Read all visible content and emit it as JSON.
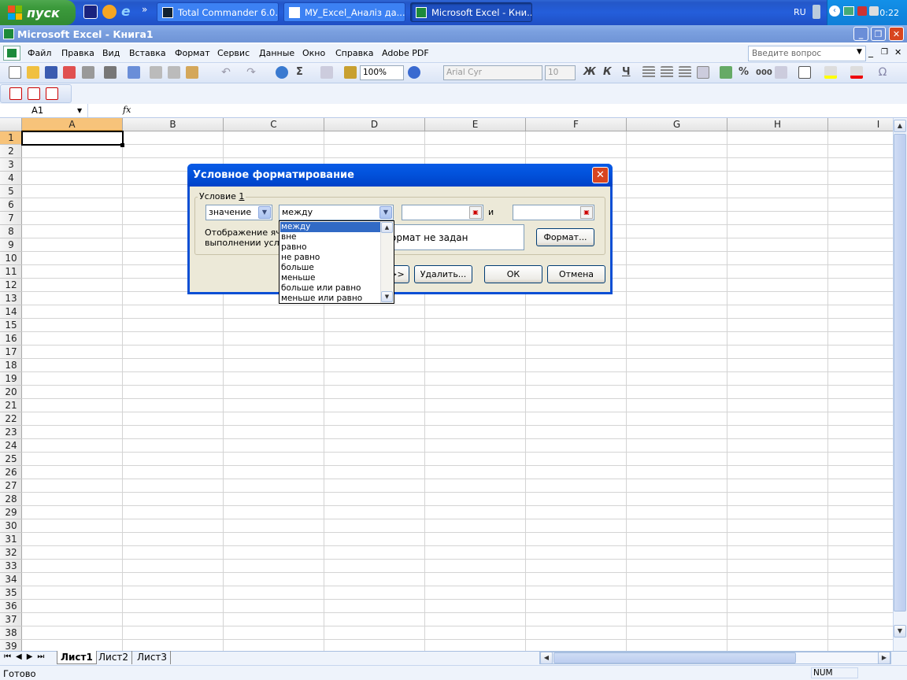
{
  "taskbar": {
    "start_label": "пуск",
    "quick_launch": [
      "total-commander-icon",
      "winamp-icon",
      "internet-explorer-icon"
    ],
    "more": "»",
    "buttons": [
      {
        "label": "Total Commander 6.0..."
      },
      {
        "label": "МУ_Excel_Аналіз да..."
      },
      {
        "label": "Microsoft Excel - Кни..."
      }
    ],
    "lang": "RU",
    "clock": "0:22"
  },
  "window": {
    "title": "Microsoft Excel - Книга1",
    "min": "_",
    "max": "❐",
    "close": "✕"
  },
  "menu": {
    "items": [
      "Файл",
      "Правка",
      "Вид",
      "Вставка",
      "Формат",
      "Сервис",
      "Данные",
      "Окно",
      "Справка",
      "Adobe PDF"
    ],
    "ask_placeholder": "Введите вопрос"
  },
  "toolbar": {
    "zoom": "100%",
    "font": "Arial Cyr",
    "size": "10",
    "bold": "Ж",
    "italic": "К",
    "underline": "Ч",
    "percent": "%",
    "thousands": "000",
    "sigma": "Σ"
  },
  "formula": {
    "namebox": "A1",
    "fx": "fx",
    "content": ""
  },
  "grid": {
    "columns": [
      "A",
      "B",
      "C",
      "D",
      "E",
      "F",
      "G",
      "H",
      "I"
    ],
    "rows": [
      "1",
      "2",
      "3",
      "4",
      "5",
      "6",
      "7",
      "8",
      "9",
      "10",
      "11",
      "12",
      "13",
      "14",
      "15",
      "16",
      "17",
      "18",
      "19",
      "20",
      "21",
      "22",
      "23",
      "24",
      "25",
      "26",
      "27",
      "28",
      "29",
      "30",
      "31",
      "32",
      "33",
      "34",
      "35",
      "36",
      "37",
      "38",
      "39"
    ],
    "active_cell": "A1"
  },
  "sheets": [
    "Лист1",
    "Лист2",
    "Лист3"
  ],
  "status": {
    "ready": "Готово",
    "num": "NUM"
  },
  "dialog": {
    "title": "Условное форматирование",
    "group_label": "Условие ",
    "group_num": "1",
    "cond_type": "значение",
    "operator": "между",
    "and_label": "и",
    "value1": "",
    "value2": "",
    "display_label_1": "Отображение яче",
    "display_label_2": "выполнении услов",
    "preview_text": "ормат не задан",
    "format_button": "Формат...",
    "also_button": ">>",
    "delete_button": "Удалить...",
    "ok_button": "ОК",
    "cancel_button": "Отмена",
    "options": [
      "между",
      "вне",
      "равно",
      "не равно",
      "больше",
      "меньше",
      "больше или равно",
      "меньше или равно"
    ],
    "selected_option": 0
  }
}
